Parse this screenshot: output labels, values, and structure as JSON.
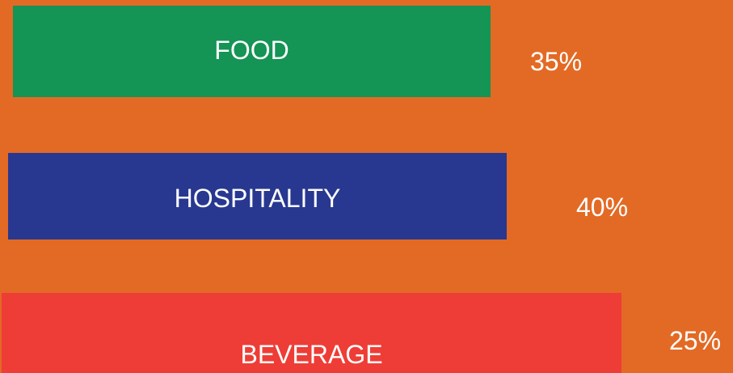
{
  "chart_data": {
    "type": "bar",
    "orientation": "horizontal",
    "categories": [
      "FOOD",
      "HOSPITALITY",
      "BEVERAGE"
    ],
    "value_labels": [
      "35%",
      "40%",
      "25%"
    ],
    "colors": {
      "background": "#E36A25",
      "bars": [
        "#149455",
        "#283890",
        "#EE3D36"
      ],
      "text": "#FFFFFF"
    }
  }
}
